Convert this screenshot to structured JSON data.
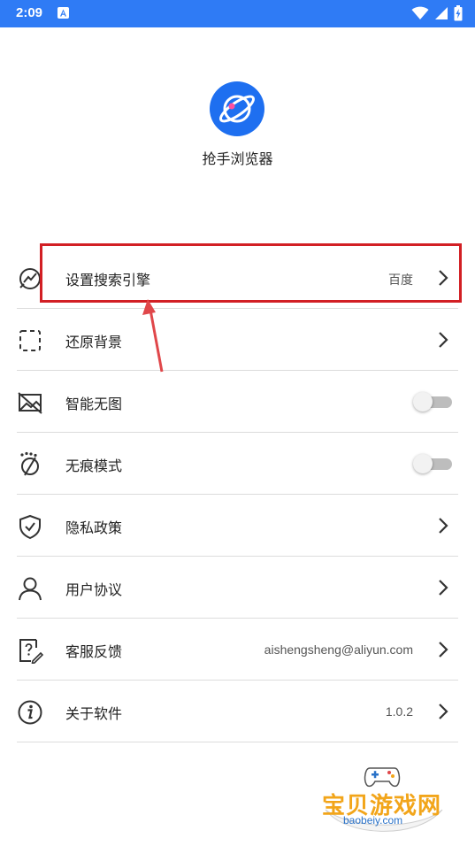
{
  "status_bar": {
    "time": "2:09",
    "icons": [
      "notification-a-icon",
      "wifi-icon",
      "signal-icon",
      "battery-charging-icon"
    ]
  },
  "app": {
    "name": "抢手浏览器",
    "logo_icon": "planet-icon",
    "accent": "#1e6ff0"
  },
  "settings": [
    {
      "label": "设置搜索引擎",
      "value": "百度",
      "icon": "search-engine-icon",
      "control": "chevron"
    },
    {
      "label": "还原背景",
      "value": "",
      "icon": "restore-background-icon",
      "control": "chevron"
    },
    {
      "label": "智能无图",
      "value": "",
      "icon": "no-image-icon",
      "control": "toggle",
      "on": false
    },
    {
      "label": "无痕模式",
      "value": "",
      "icon": "incognito-icon",
      "control": "toggle",
      "on": false
    },
    {
      "label": "隐私政策",
      "value": "",
      "icon": "shield-check-icon",
      "control": "chevron"
    },
    {
      "label": "用户协议",
      "value": "",
      "icon": "user-icon",
      "control": "chevron"
    },
    {
      "label": "客服反馈",
      "value": "aishengsheng@aliyun.com",
      "icon": "feedback-icon",
      "control": "chevron"
    },
    {
      "label": "关于软件",
      "value": "1.0.2",
      "icon": "info-icon",
      "control": "chevron"
    }
  ],
  "annotation": {
    "highlight_color": "#d21f24"
  },
  "watermark": {
    "text": "宝贝游戏网",
    "url": "baobeiy.com"
  }
}
